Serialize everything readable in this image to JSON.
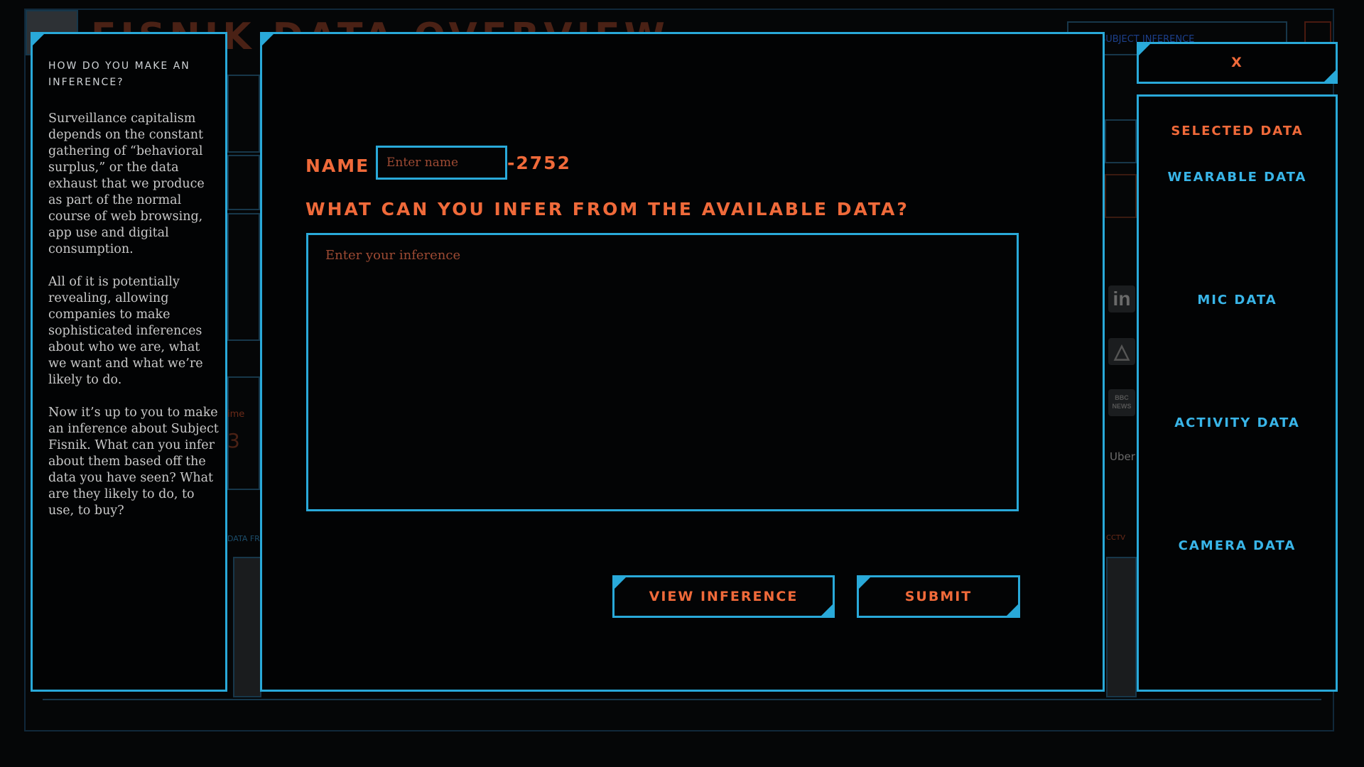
{
  "background": {
    "title": "FISNIK DATA OVERVIEW",
    "fragments": {
      "time_label": "ime",
      "time_value": "3",
      "data_from": "DATA FRO",
      "cctv": "CCTV",
      "uber": "Uber",
      "linkedin": "in",
      "bbc": "BBC NEWS",
      "subject_inference": "SUBJECT INFERENCE"
    }
  },
  "info_panel": {
    "heading": "How do you make an inference?",
    "paragraphs": [
      "Surveillance capitalism depends on the constant gathering of “behavioral surplus,” or the data exhaust that we produce as part of the normal course of web browsing, app use and digital consumption.",
      "All of it is potentially revealing, allowing companies to make sophisticated inferences about who we are, what we want and what we’re likely to do.",
      "Now it’s up to you to make an inference about Subject Fisnik. What can you infer about them based off the data you have seen? What are they likely to do, to use, to buy?"
    ]
  },
  "modal": {
    "name_label": "NAME",
    "name_placeholder": "Enter name",
    "name_value": "",
    "name_suffix": "-2752",
    "question": "WHAT CAN YOU INFER FROM THE AVAILABLE DATA?",
    "inference_placeholder": "Enter your inference",
    "inference_value": "",
    "view_inference_label": "VIEW INFERENCE",
    "submit_label": "SUBMIT"
  },
  "close_label": "X",
  "selected_data": {
    "title": "SELECTED DATA",
    "items": [
      "WEARABLE DATA",
      "MIC DATA",
      "ACTIVITY DATA",
      "CAMERA DATA"
    ]
  },
  "colors": {
    "accent_blue": "#29a9d9",
    "accent_orange": "#f06a3a",
    "background": "#050607"
  }
}
